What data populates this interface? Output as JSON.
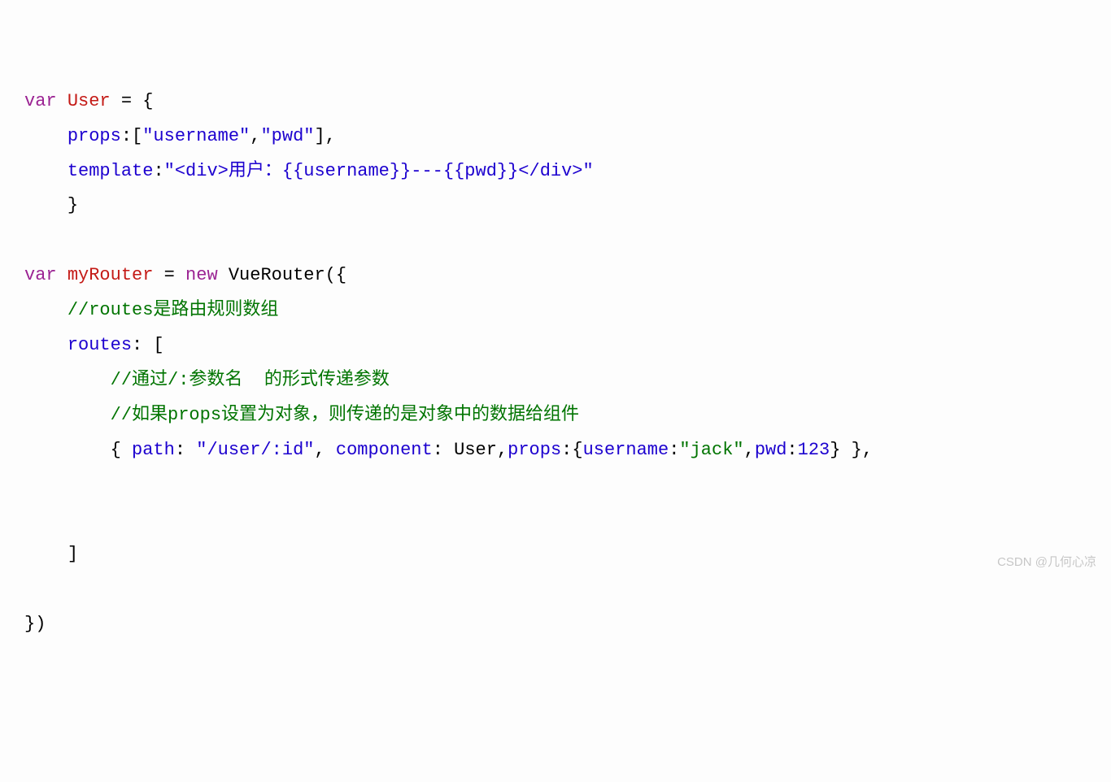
{
  "code": {
    "l1_var": "var",
    "l1_user": "User",
    "l1_eq": " = {",
    "l2_indent": "    ",
    "l2_props": "props",
    "l2_col": ":",
    "l2_br1": "[",
    "l2_s1": "\"username\"",
    "l2_comma": ",",
    "l2_s2": "\"pwd\"",
    "l2_br2": "],",
    "l3_indent": "    ",
    "l3_template": "template",
    "l3_col": ":",
    "l3_str": "\"<div>用户：{{username}}---{{pwd}}</div>\"",
    "l4_indent": "    ",
    "l4_close": "}",
    "l6_var": "var",
    "l6_myr": "myRouter",
    "l6_eq": " = ",
    "l6_new": "new",
    "l6_vr": " VueRouter({",
    "l7_indent": "    ",
    "l7_cmt": "//routes是路由规则数组",
    "l8_indent": "    ",
    "l8_routes": "routes",
    "l8_col": ": [",
    "l9_indent": "        ",
    "l9_cmt": "//通过/:参数名  的形式传递参数",
    "l10_indent": "        ",
    "l10_cmt": "//如果props设置为对象，则传递的是对象中的数据给组件",
    "l11_indent": "        ",
    "l11_open": "{ ",
    "l11_path": "path",
    "l11_col1": ": ",
    "l11_pathstr": "\"/user/:id\"",
    "l11_c1": ", ",
    "l11_comp": "component",
    "l11_col2": ": ",
    "l11_userref": "User",
    "l11_c2": ",",
    "l11_props": "props",
    "l11_col3": ":",
    "l11_bopen": "{",
    "l11_un": "username",
    "l11_col4": ":",
    "l11_jack": "\"jack\"",
    "l11_c3": ",",
    "l11_pwd": "pwd",
    "l11_col5": ":",
    "l11_num": "123",
    "l11_bclose": "} },",
    "l14_indent": "    ",
    "l14_close": "]",
    "l16_close": "})"
  },
  "watermark": "CSDN @几何心凉"
}
